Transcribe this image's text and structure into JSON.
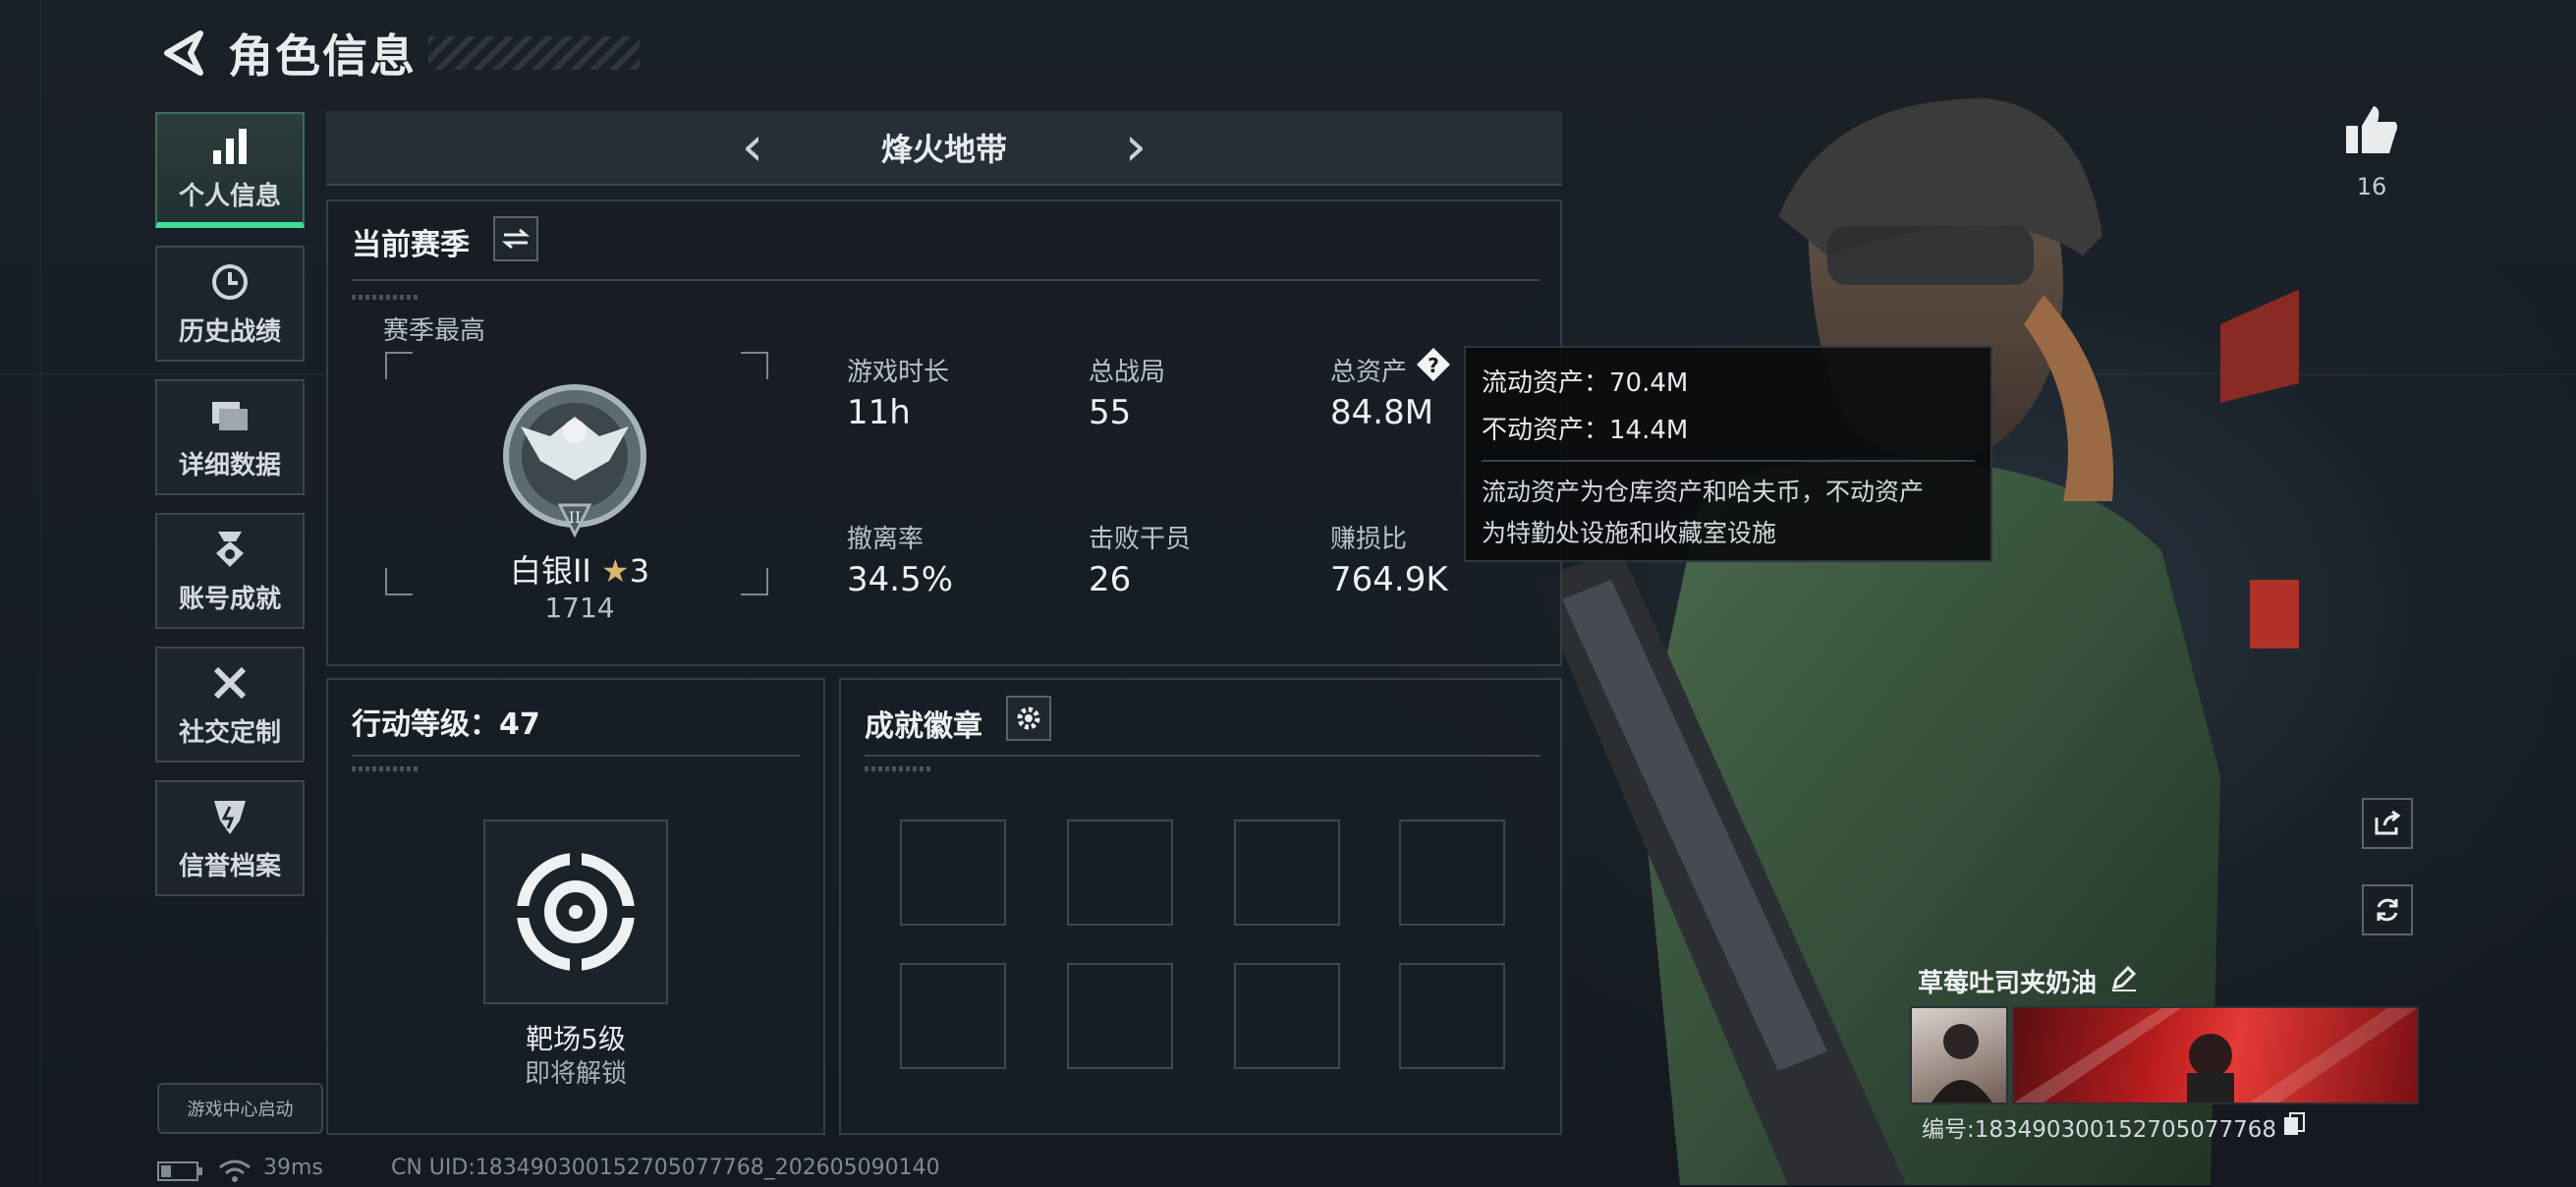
{
  "header": {
    "title": "角色信息"
  },
  "sidebar": {
    "items": [
      {
        "label": "个人信息",
        "icon": "bar-chart-icon",
        "active": true
      },
      {
        "label": "历史战绩",
        "icon": "history-clock-icon"
      },
      {
        "label": "详细数据",
        "icon": "folders-icon"
      },
      {
        "label": "账号成就",
        "icon": "achievement-medal-icon"
      },
      {
        "label": "社交定制",
        "icon": "tools-icon"
      },
      {
        "label": "信誉档案",
        "icon": "shield-badge-icon"
      }
    ],
    "game_center": "游戏中心启动"
  },
  "mode": {
    "name": "烽火地带"
  },
  "season": {
    "title": "当前赛季",
    "best_label": "赛季最高",
    "rank_name": "白银II",
    "rank_stars": "3",
    "rank_points": "1714",
    "stats": [
      {
        "label": "游戏时长",
        "value": "11h"
      },
      {
        "label": "总战局",
        "value": "55"
      },
      {
        "label": "总资产",
        "value": "84.8M"
      },
      {
        "label": "撤离率",
        "value": "34.5%"
      },
      {
        "label": "击败干员",
        "value": "26"
      },
      {
        "label": "赚损比",
        "value": "764.9K"
      }
    ]
  },
  "tooltip": {
    "liquid": "流动资产：70.4M",
    "fixed": "不动资产：14.4M",
    "desc1": "流动资产为仓库资产和哈夫币，不动资产",
    "desc2": "为特勤处设施和收藏室设施"
  },
  "action_level": {
    "title": "行动等级：47",
    "item_name": "靶场5级",
    "item_status": "即将解锁"
  },
  "badges": {
    "title": "成就徽章"
  },
  "profile": {
    "likes": "16",
    "nickname": "草莓吐司夹奶油",
    "id_text": "编号:1834903001527050777​68"
  },
  "status_bar": {
    "ping": "39ms",
    "uid": "CN UID:1834903001527050777​68_202605090140"
  },
  "colors": {
    "accent": "#3ddc97",
    "panel": "#181e25",
    "border": "#333d46"
  }
}
